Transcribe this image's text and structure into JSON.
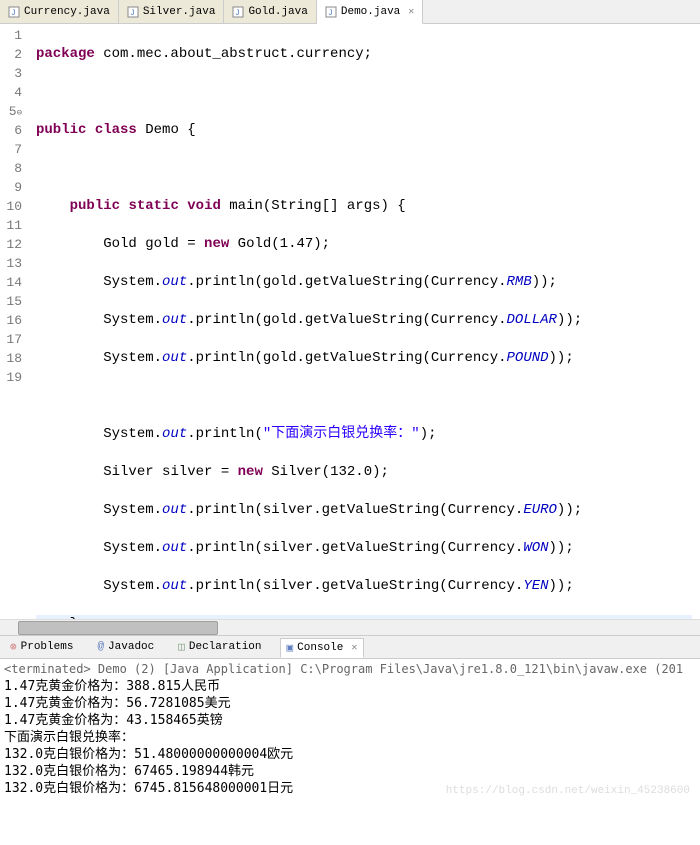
{
  "tabs": [
    {
      "label": "Currency.java",
      "active": false
    },
    {
      "label": "Silver.java",
      "active": false
    },
    {
      "label": "Gold.java",
      "active": false
    },
    {
      "label": "Demo.java",
      "active": true
    }
  ],
  "lineNumbers": [
    "1",
    "2",
    "3",
    "4",
    "5",
    "6",
    "7",
    "8",
    "9",
    "10",
    "11",
    "12",
    "13",
    "14",
    "15",
    "16",
    "17",
    "18",
    "19"
  ],
  "code": {
    "l1": {
      "kw1": "package",
      "txt": " com.mec.about_abstruct.currency;"
    },
    "l3": {
      "kw1": "public",
      "kw2": "class",
      "name": " Demo {"
    },
    "l5": {
      "kw1": "public",
      "kw2": "static",
      "kw3": "void",
      "name": " main(String[] args) {"
    },
    "l6": {
      "type": "Gold",
      "var": " gold = ",
      "kw": "new",
      "rest": " Gold(1.47);"
    },
    "l7": {
      "pre": "System.",
      "fld": "out",
      "mid": ".println(gold.getValueString(Currency.",
      "c": "RMB",
      "end": "));"
    },
    "l8": {
      "pre": "System.",
      "fld": "out",
      "mid": ".println(gold.getValueString(Currency.",
      "c": "DOLLAR",
      "end": "));"
    },
    "l9": {
      "pre": "System.",
      "fld": "out",
      "mid": ".println(gold.getValueString(Currency.",
      "c": "POUND",
      "end": "));"
    },
    "l11": {
      "pre": "System.",
      "fld": "out",
      "mid": ".println(",
      "str": "\"下面演示白银兑换率：\"",
      "end": ");"
    },
    "l12": {
      "type": "Silver",
      "var": " silver = ",
      "kw": "new",
      "rest": " Silver(132.0);"
    },
    "l13": {
      "pre": "System.",
      "fld": "out",
      "mid": ".println(silver.getValueString(Currency.",
      "c": "EURO",
      "end": "));"
    },
    "l14": {
      "pre": "System.",
      "fld": "out",
      "mid": ".println(silver.getValueString(Currency.",
      "c": "WON",
      "end": "));"
    },
    "l15": {
      "pre": "System.",
      "fld": "out",
      "mid": ".println(silver.getValueString(Currency.",
      "c": "YEN",
      "end": "));"
    },
    "l16": "    }",
    "l18": "}"
  },
  "views": [
    {
      "label": "Problems",
      "color": "#d08080"
    },
    {
      "label": "Javadoc",
      "color": "#6080c0"
    },
    {
      "label": "Declaration",
      "color": "#80a080"
    },
    {
      "label": "Console",
      "color": "#6080c0",
      "active": true
    }
  ],
  "console": {
    "header": "<terminated> Demo (2) [Java Application] C:\\Program Files\\Java\\jre1.8.0_121\\bin\\javaw.exe (201",
    "lines": [
      "1.47克黄金价格为：388.815人民币",
      "1.47克黄金价格为：56.7281085美元",
      "1.47克黄金价格为：43.158465英镑",
      "下面演示白银兑换率：",
      "132.0克白银价格为：51.48000000000004欧元",
      "132.0克白银价格为：67465.198944韩元",
      "132.0克白银价格为：6745.815648000001日元"
    ]
  },
  "watermark": "https://blog.csdn.net/weixin_45238600",
  "foldMarker": "⊖",
  "closeX": "✕"
}
